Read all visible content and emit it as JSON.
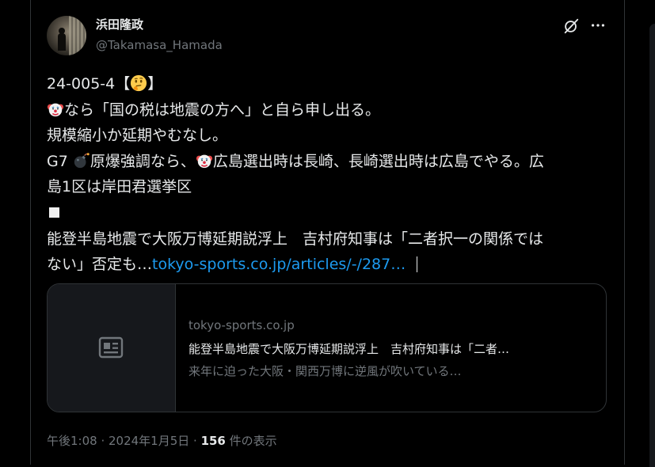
{
  "author": {
    "display_name": "浜田隆政",
    "handle": "@Takamasa_Hamada"
  },
  "header_icons": [
    "grok-icon",
    "more-icon"
  ],
  "tweet": {
    "line1_prefix": "24-005-4【",
    "line1_suffix": "】",
    "line2_text": "なら「国の税は地震の方へ」と自ら申し出る。",
    "line3_text": "規模縮小か延期やむなし。",
    "line4_a": "G7 ",
    "line4_b": "原爆強調なら、",
    "line4_c": "広島選出時は長崎、長崎選出時は広島でやる。広",
    "line5_text": "島1区は岸田君選挙区",
    "line7_text": "能登半島地震で大阪万博延期説浮上　吉村府知事は「二者択一の関係では",
    "line8_text": "ない」否定も…",
    "link_text": "tokyo-sports.co.jp/articles/-/287…",
    "emojis": [
      "thinking-face",
      "clown-face",
      "bomb",
      "clown-face"
    ]
  },
  "card": {
    "domain": "tokyo-sports.co.jp",
    "title": "能登半島地震で大阪万博延期説浮上　吉村府知事は「二者…",
    "description": "来年に迫った大阪・関西万博に逆風が吹いている…",
    "thumb_icon": "article-icon"
  },
  "meta": {
    "time": "午後1:08 · 2024年1月5日 · ",
    "views_count": "156",
    "views_label": " 件の表示"
  },
  "colors": {
    "background": "#000000",
    "text": "#e7e9ea",
    "secondary": "#71767b",
    "link": "#1d9bf0",
    "border": "#2f3336"
  }
}
